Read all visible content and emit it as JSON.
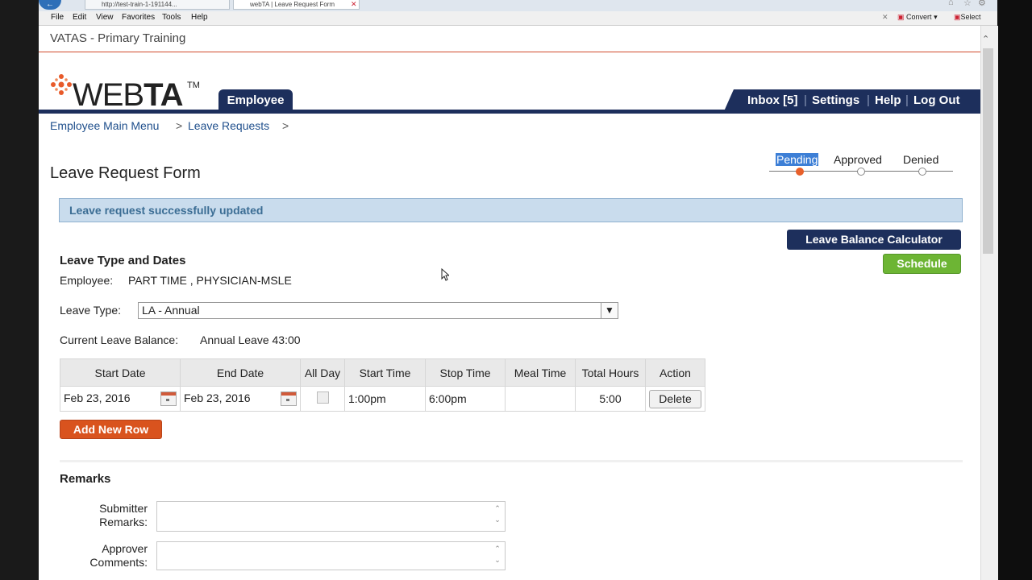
{
  "browser": {
    "tabs": [
      {
        "label": "http://test-train-1-191144..."
      },
      {
        "label": "webTA | Leave Request Form"
      }
    ],
    "menu": [
      "File",
      "Edit",
      "View",
      "Favorites",
      "Tools",
      "Help"
    ],
    "toolbar": {
      "convert_label": "Convert",
      "select_label": "Select"
    }
  },
  "site": {
    "title": "VATAS - Primary Training",
    "logo_text_light": "WEB",
    "logo_text_bold": "TA",
    "logo_tm": "TM",
    "accent_color": "#d14a2b",
    "nav_color": "#1d2f5c"
  },
  "nav": {
    "employee_tab": "Employee",
    "links": [
      {
        "label": "Inbox [5]"
      },
      {
        "label": "Settings"
      },
      {
        "label": "Help"
      },
      {
        "label": "Log Out"
      }
    ],
    "separator": "|"
  },
  "breadcrumb": {
    "items": [
      "Employee Main Menu",
      "Leave Requests"
    ],
    "separator": ">"
  },
  "form": {
    "title": "Leave Request Form",
    "status_steps": [
      "Pending",
      "Approved",
      "Denied"
    ],
    "current_status": "Pending",
    "alert": "Leave request successfully updated",
    "calc_button": "Leave Balance Calculator",
    "schedule_button": "Schedule",
    "section_title": "Leave Type and Dates",
    "employee_label": "Employee:",
    "employee_value": "PART TIME , PHYSICIAN-MSLE",
    "leave_type_label": "Leave Type:",
    "leave_type_value": "LA - Annual",
    "balance_label": "Current Leave Balance:",
    "balance_value": "Annual Leave 43:00",
    "table": {
      "headers": [
        "Start Date",
        "End Date",
        "All Day",
        "Start Time",
        "Stop Time",
        "Meal Time",
        "Total Hours",
        "Action"
      ],
      "rows": [
        {
          "start_date": "Feb 23, 2016",
          "end_date": "Feb 23, 2016",
          "all_day": false,
          "start_time": "1:00pm",
          "stop_time": "6:00pm",
          "meal_time": "",
          "total_hours": "5:00",
          "action": "Delete"
        }
      ]
    },
    "add_row_button": "Add New Row",
    "remarks_title": "Remarks",
    "submitter_label": "Submitter Remarks:",
    "approver_label": "Approver Comments:"
  }
}
